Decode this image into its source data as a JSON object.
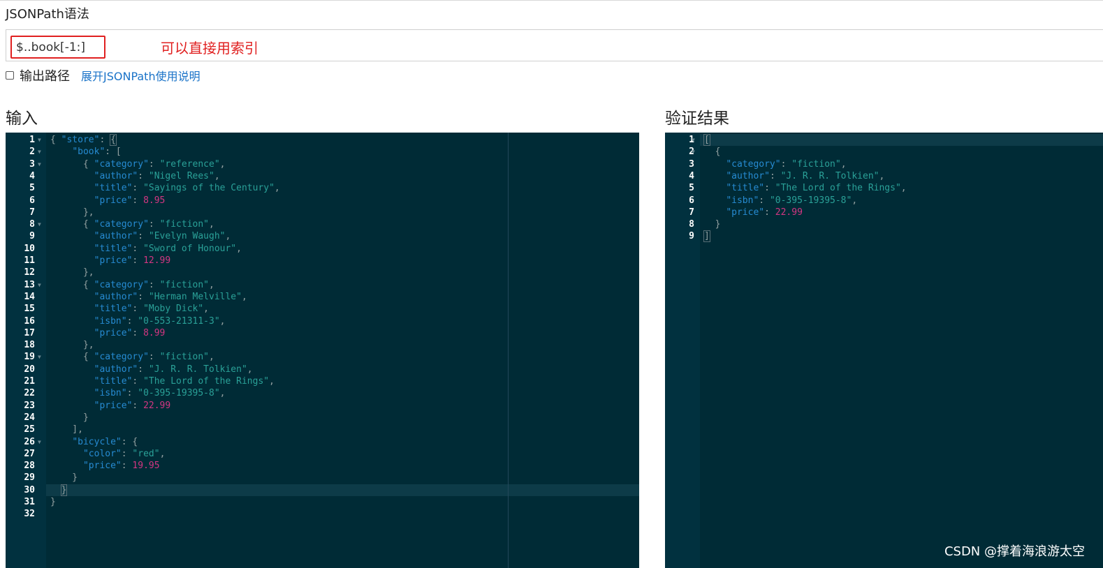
{
  "page": {
    "title": "JSONPath语法"
  },
  "query": {
    "value": "$..book[-1:]",
    "annotation": "可以直接用索引"
  },
  "options": {
    "output_path_label": "输出路径",
    "output_path_checked": false,
    "help_link": "展开JSONPath使用说明"
  },
  "input_panel": {
    "title": "输入",
    "active_line": 30,
    "lines": [
      [
        [
          "p",
          "{ "
        ],
        [
          "k",
          "\"store\""
        ],
        [
          "p",
          ": "
        ],
        [
          "bm",
          "{"
        ]
      ],
      [
        [
          "p",
          "    "
        ],
        [
          "k",
          "\"book\""
        ],
        [
          "p",
          ": ["
        ]
      ],
      [
        [
          "p",
          "      { "
        ],
        [
          "k",
          "\"category\""
        ],
        [
          "p",
          ": "
        ],
        [
          "s",
          "\"reference\""
        ],
        [
          "p",
          ","
        ]
      ],
      [
        [
          "p",
          "        "
        ],
        [
          "k",
          "\"author\""
        ],
        [
          "p",
          ": "
        ],
        [
          "s",
          "\"Nigel Rees\""
        ],
        [
          "p",
          ","
        ]
      ],
      [
        [
          "p",
          "        "
        ],
        [
          "k",
          "\"title\""
        ],
        [
          "p",
          ": "
        ],
        [
          "s",
          "\"Sayings of the Century\""
        ],
        [
          "p",
          ","
        ]
      ],
      [
        [
          "p",
          "        "
        ],
        [
          "k",
          "\"price\""
        ],
        [
          "p",
          ": "
        ],
        [
          "n",
          "8.95"
        ]
      ],
      [
        [
          "p",
          "      },"
        ]
      ],
      [
        [
          "p",
          "      { "
        ],
        [
          "k",
          "\"category\""
        ],
        [
          "p",
          ": "
        ],
        [
          "s",
          "\"fiction\""
        ],
        [
          "p",
          ","
        ]
      ],
      [
        [
          "p",
          "        "
        ],
        [
          "k",
          "\"author\""
        ],
        [
          "p",
          ": "
        ],
        [
          "s",
          "\"Evelyn Waugh\""
        ],
        [
          "p",
          ","
        ]
      ],
      [
        [
          "p",
          "        "
        ],
        [
          "k",
          "\"title\""
        ],
        [
          "p",
          ": "
        ],
        [
          "s",
          "\"Sword of Honour\""
        ],
        [
          "p",
          ","
        ]
      ],
      [
        [
          "p",
          "        "
        ],
        [
          "k",
          "\"price\""
        ],
        [
          "p",
          ": "
        ],
        [
          "n",
          "12.99"
        ]
      ],
      [
        [
          "p",
          "      },"
        ]
      ],
      [
        [
          "p",
          "      { "
        ],
        [
          "k",
          "\"category\""
        ],
        [
          "p",
          ": "
        ],
        [
          "s",
          "\"fiction\""
        ],
        [
          "p",
          ","
        ]
      ],
      [
        [
          "p",
          "        "
        ],
        [
          "k",
          "\"author\""
        ],
        [
          "p",
          ": "
        ],
        [
          "s",
          "\"Herman Melville\""
        ],
        [
          "p",
          ","
        ]
      ],
      [
        [
          "p",
          "        "
        ],
        [
          "k",
          "\"title\""
        ],
        [
          "p",
          ": "
        ],
        [
          "s",
          "\"Moby Dick\""
        ],
        [
          "p",
          ","
        ]
      ],
      [
        [
          "p",
          "        "
        ],
        [
          "k",
          "\"isbn\""
        ],
        [
          "p",
          ": "
        ],
        [
          "s",
          "\"0-553-21311-3\""
        ],
        [
          "p",
          ","
        ]
      ],
      [
        [
          "p",
          "        "
        ],
        [
          "k",
          "\"price\""
        ],
        [
          "p",
          ": "
        ],
        [
          "n",
          "8.99"
        ]
      ],
      [
        [
          "p",
          "      },"
        ]
      ],
      [
        [
          "p",
          "      { "
        ],
        [
          "k",
          "\"category\""
        ],
        [
          "p",
          ": "
        ],
        [
          "s",
          "\"fiction\""
        ],
        [
          "p",
          ","
        ]
      ],
      [
        [
          "p",
          "        "
        ],
        [
          "k",
          "\"author\""
        ],
        [
          "p",
          ": "
        ],
        [
          "s",
          "\"J. R. R. Tolkien\""
        ],
        [
          "p",
          ","
        ]
      ],
      [
        [
          "p",
          "        "
        ],
        [
          "k",
          "\"title\""
        ],
        [
          "p",
          ": "
        ],
        [
          "s",
          "\"The Lord of the Rings\""
        ],
        [
          "p",
          ","
        ]
      ],
      [
        [
          "p",
          "        "
        ],
        [
          "k",
          "\"isbn\""
        ],
        [
          "p",
          ": "
        ],
        [
          "s",
          "\"0-395-19395-8\""
        ],
        [
          "p",
          ","
        ]
      ],
      [
        [
          "p",
          "        "
        ],
        [
          "k",
          "\"price\""
        ],
        [
          "p",
          ": "
        ],
        [
          "n",
          "22.99"
        ]
      ],
      [
        [
          "p",
          "      }"
        ]
      ],
      [
        [
          "p",
          "    ],"
        ]
      ],
      [
        [
          "p",
          "    "
        ],
        [
          "k",
          "\"bicycle\""
        ],
        [
          "p",
          ": {"
        ]
      ],
      [
        [
          "p",
          "      "
        ],
        [
          "k",
          "\"color\""
        ],
        [
          "p",
          ": "
        ],
        [
          "s",
          "\"red\""
        ],
        [
          "p",
          ","
        ]
      ],
      [
        [
          "p",
          "      "
        ],
        [
          "k",
          "\"price\""
        ],
        [
          "p",
          ": "
        ],
        [
          "n",
          "19.95"
        ]
      ],
      [
        [
          "p",
          "    }"
        ]
      ],
      [
        [
          "p",
          "  "
        ],
        [
          "bm",
          "}"
        ]
      ],
      [
        [
          "p",
          "}"
        ]
      ],
      []
    ],
    "fold_lines": [
      1,
      2,
      3,
      8,
      13,
      19,
      26
    ]
  },
  "result_panel": {
    "title": "验证结果",
    "active_line": 1,
    "lines": [
      [
        [
          "bm",
          "["
        ]
      ],
      [
        [
          "p",
          "  {"
        ]
      ],
      [
        [
          "p",
          "    "
        ],
        [
          "k",
          "\"category\""
        ],
        [
          "p",
          ": "
        ],
        [
          "s",
          "\"fiction\""
        ],
        [
          "p",
          ","
        ]
      ],
      [
        [
          "p",
          "    "
        ],
        [
          "k",
          "\"author\""
        ],
        [
          "p",
          ": "
        ],
        [
          "s",
          "\"J. R. R. Tolkien\""
        ],
        [
          "p",
          ","
        ]
      ],
      [
        [
          "p",
          "    "
        ],
        [
          "k",
          "\"title\""
        ],
        [
          "p",
          ": "
        ],
        [
          "s",
          "\"The Lord of the Rings\""
        ],
        [
          "p",
          ","
        ]
      ],
      [
        [
          "p",
          "    "
        ],
        [
          "k",
          "\"isbn\""
        ],
        [
          "p",
          ": "
        ],
        [
          "s",
          "\"0-395-19395-8\""
        ],
        [
          "p",
          ","
        ]
      ],
      [
        [
          "p",
          "    "
        ],
        [
          "k",
          "\"price\""
        ],
        [
          "p",
          ": "
        ],
        [
          "n",
          "22.99"
        ]
      ],
      [
        [
          "p",
          "  }"
        ]
      ],
      [
        [
          "bm",
          "]"
        ]
      ]
    ],
    "fold_lines": [
      1,
      2
    ]
  },
  "watermark": "CSDN @撑着海浪游太空",
  "colors": {
    "editor_bg": "#002b36",
    "key": "#268bd2",
    "string": "#2aa198",
    "number": "#d33682",
    "annotation": "#e02020",
    "link": "#1a73c8"
  }
}
